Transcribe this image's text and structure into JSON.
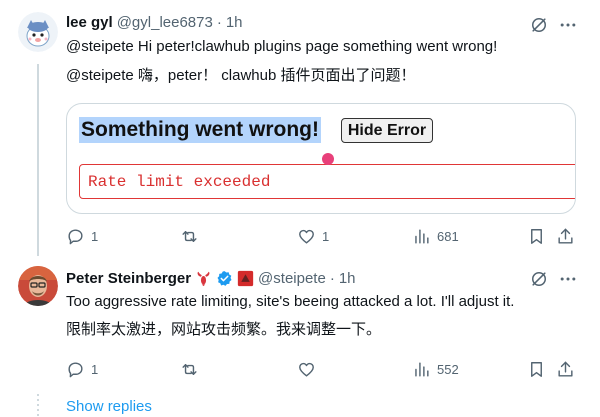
{
  "tweet1": {
    "display_name": "lee gyl",
    "handle": "@gyl_lee6873",
    "separator": "·",
    "time": "1h",
    "line1": "@steipete  Hi peter!clawhub plugins page something went wrong!",
    "line2": "@steipete 嗨，peter！ clawhub 插件页面出了问题！",
    "card": {
      "error_title": "Something went wrong!",
      "hide_button": "Hide Error",
      "error_message": "Rate limit exceeded"
    },
    "actions": {
      "replies": "1",
      "reposts": "",
      "likes": "1",
      "views": "681"
    }
  },
  "tweet2": {
    "display_name": "Peter Steinberger",
    "handle": "@steipete",
    "separator": "·",
    "time": "1h",
    "line1": "Too aggressive rate limiting, site's beeing attacked a lot. I'll adjust it.",
    "line2": "限制率太激进，网站攻击频繁。我来调整一下。",
    "actions": {
      "replies": "1",
      "reposts": "",
      "likes": "",
      "views": "552"
    }
  },
  "show_replies": "Show replies",
  "icons": [
    "grok-icon",
    "more-icon",
    "reply-icon",
    "repost-icon",
    "like-icon",
    "views-icon",
    "bookmark-icon",
    "share-icon",
    "lobster-emoji-icon",
    "verified-badge-icon",
    "affiliate-badge-icon"
  ],
  "colors": {
    "link": "#1d9bf0",
    "error": "#d93030",
    "highlight": "#b3d4fc",
    "verified": "#1d9bf0"
  }
}
